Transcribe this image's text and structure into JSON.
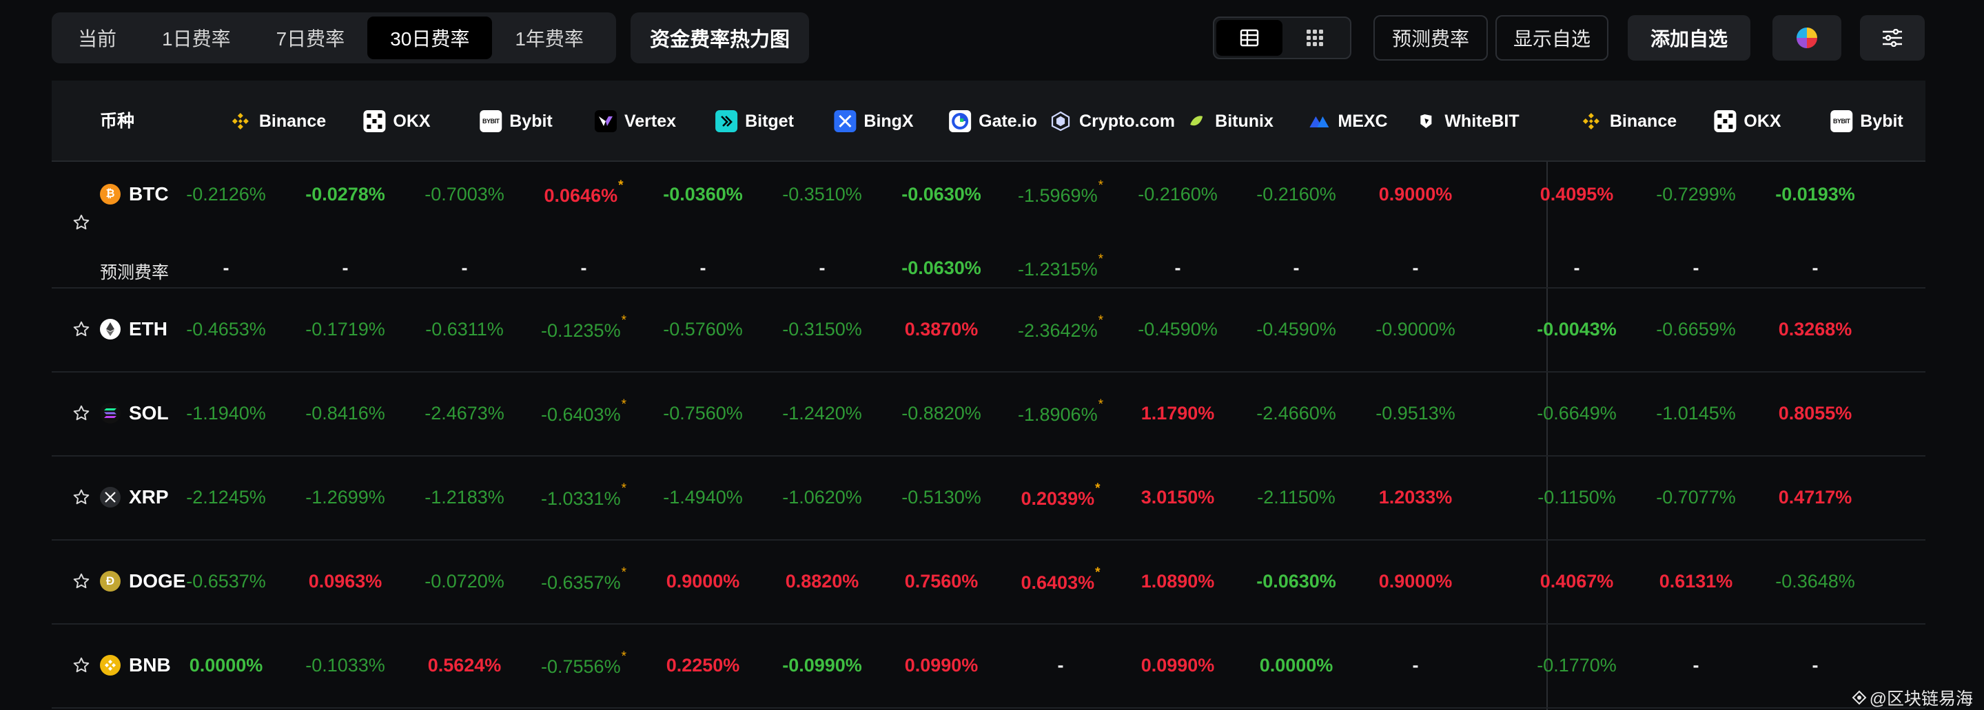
{
  "periods": [
    "当前",
    "1日费率",
    "7日费率",
    "30日费率",
    "1年费率"
  ],
  "active_period": "30日费率",
  "heatmap_label": "资金费率热力图",
  "forecast_label": "预测费率",
  "show_favorites_label": "显示自选",
  "add_favorites_label": "添加自选",
  "coin_header": "币种",
  "exchanges": [
    "Binance",
    "OKX",
    "Bybit",
    "Vertex",
    "Bitget",
    "BingX",
    "Gate.io",
    "Crypto.com",
    "Bitunix",
    "MEXC",
    "WhiteBIT",
    "Binance",
    "OKX",
    "Bybit"
  ],
  "exchange_icons": [
    "binance-icon",
    "okx-icon",
    "bybit-icon",
    "vertex-icon",
    "bitget-icon",
    "bingx-icon",
    "gateio-icon",
    "cryptocom-icon",
    "bitunix-icon",
    "mexc-icon",
    "whitebit-icon",
    "binance-icon",
    "okx-icon",
    "bybit-icon"
  ],
  "predicted_rate_label": "预测费率",
  "rows": [
    {
      "coin": "BTC",
      "icon": "btc-icon",
      "values": [
        "-0.2126%",
        "-0.0278%",
        "-0.7003%",
        "0.0646%",
        "-0.0360%",
        "-0.3510%",
        "-0.0630%",
        "-1.5969%",
        "-0.2160%",
        "-0.2160%",
        "0.9000%",
        "0.4095%",
        "-0.7299%",
        "-0.0193%"
      ],
      "predicted": [
        "-",
        "-",
        "-",
        "-",
        "-",
        "-",
        "-0.0630%",
        "-1.2315%",
        "-",
        "-",
        "-",
        "-",
        "-",
        "-"
      ]
    },
    {
      "coin": "ETH",
      "icon": "eth-icon",
      "values": [
        "-0.4653%",
        "-0.1719%",
        "-0.6311%",
        "-0.1235%",
        "-0.5760%",
        "-0.3150%",
        "0.3870%",
        "-2.3642%",
        "-0.4590%",
        "-0.4590%",
        "-0.9000%",
        "-0.0043%",
        "-0.6659%",
        "0.3268%"
      ]
    },
    {
      "coin": "SOL",
      "icon": "sol-icon",
      "values": [
        "-1.1940%",
        "-0.8416%",
        "-2.4673%",
        "-0.6403%",
        "-0.7560%",
        "-1.2420%",
        "-0.8820%",
        "-1.8906%",
        "1.1790%",
        "-2.4660%",
        "-0.9513%",
        "-0.6649%",
        "-1.0145%",
        "0.8055%"
      ]
    },
    {
      "coin": "XRP",
      "icon": "xrp-icon",
      "values": [
        "-2.1245%",
        "-1.2699%",
        "-1.2183%",
        "-1.0331%",
        "-1.4940%",
        "-1.0620%",
        "-0.5130%",
        "0.2039%",
        "3.0150%",
        "-2.1150%",
        "1.2033%",
        "-0.1150%",
        "-0.7077%",
        "0.4717%"
      ]
    },
    {
      "coin": "DOGE",
      "icon": "doge-icon",
      "values": [
        "-0.6537%",
        "0.0963%",
        "-0.0720%",
        "-0.6357%",
        "0.9000%",
        "0.8820%",
        "0.7560%",
        "0.6403%",
        "1.0890%",
        "-0.0630%",
        "0.9000%",
        "0.4067%",
        "0.6131%",
        "-0.3648%"
      ]
    },
    {
      "coin": "BNB",
      "icon": "bnb-icon",
      "values": [
        "0.0000%",
        "-0.1033%",
        "0.5624%",
        "-0.7556%",
        "0.2250%",
        "-0.0990%",
        "0.0990%",
        "-",
        "0.0990%",
        "0.0000%",
        "-",
        "-0.1770%",
        "-",
        "-"
      ]
    }
  ],
  "watermark": "@区块链易海"
}
